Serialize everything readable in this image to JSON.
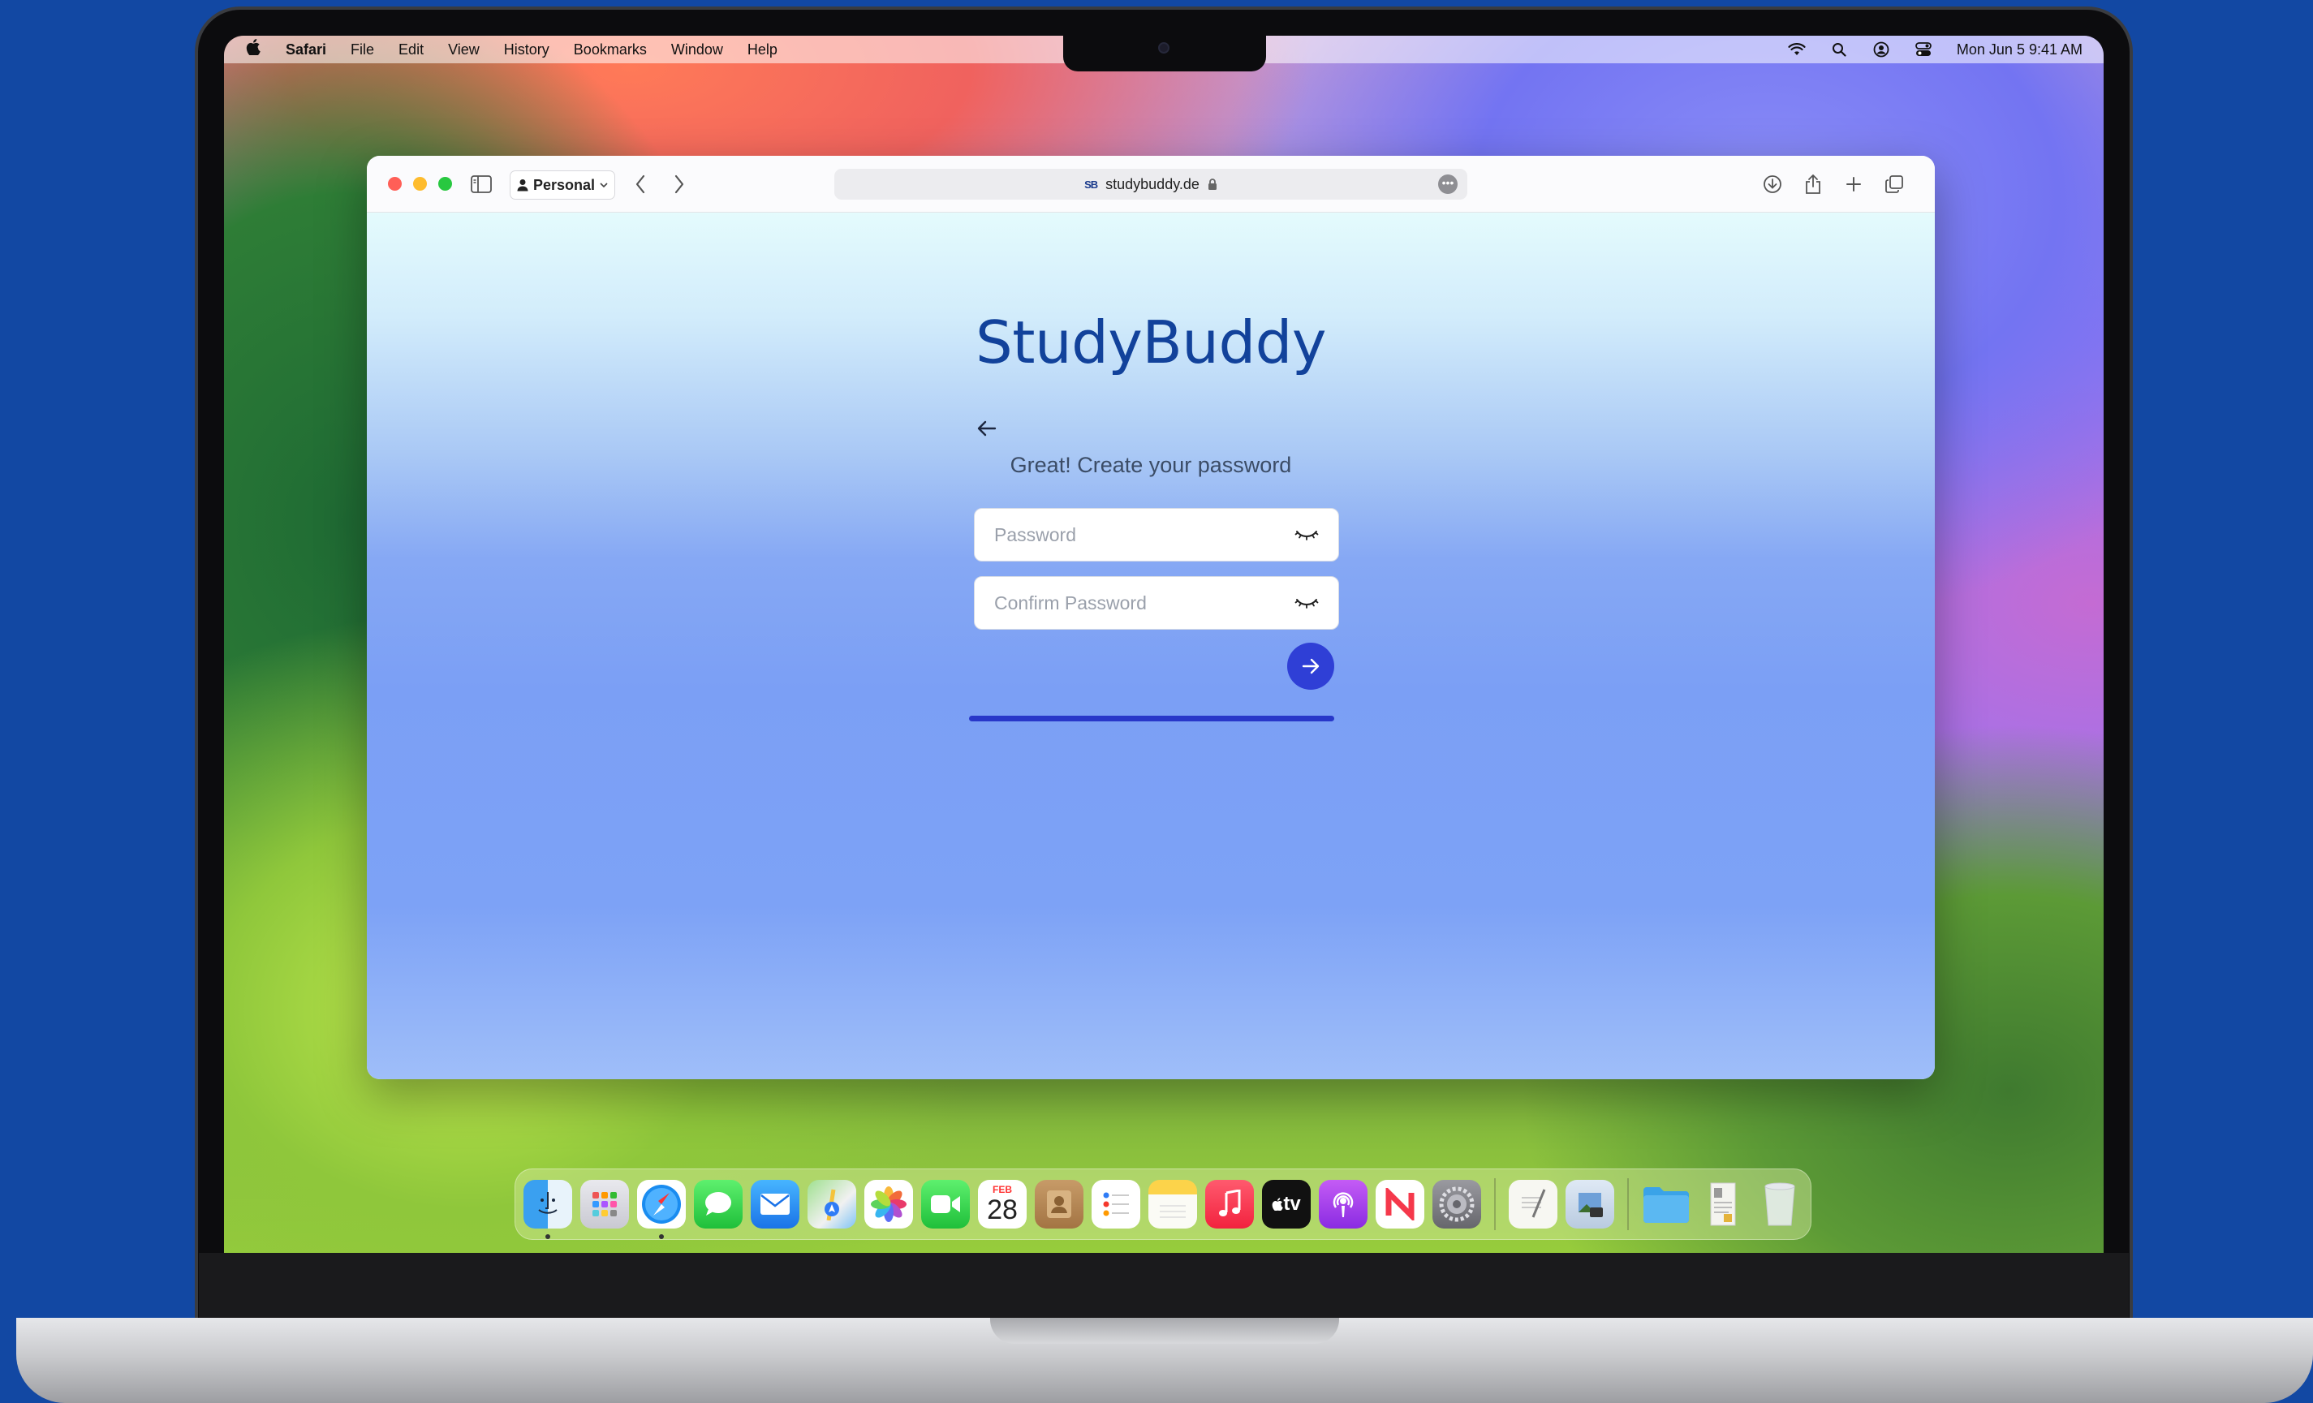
{
  "menubar": {
    "app_name": "Safari",
    "menus": [
      "File",
      "Edit",
      "View",
      "History",
      "Bookmarks",
      "Window",
      "Help"
    ],
    "clock": "Mon Jun 5  9:41 AM"
  },
  "browser": {
    "profile_label": "Personal",
    "favicon_text": "SB",
    "url": "studybuddy.de"
  },
  "page": {
    "brand": "StudyBuddy",
    "subtitle": "Great! Create your password",
    "password_placeholder": "Password",
    "confirm_placeholder": "Confirm Password",
    "progress": 1.0
  },
  "dock": {
    "calendar_month": "FEB",
    "calendar_day": "28",
    "tv_label": "tv"
  },
  "colors": {
    "brand": "#12429b",
    "accent": "#2f3fd6",
    "progress": "#2837c9"
  }
}
